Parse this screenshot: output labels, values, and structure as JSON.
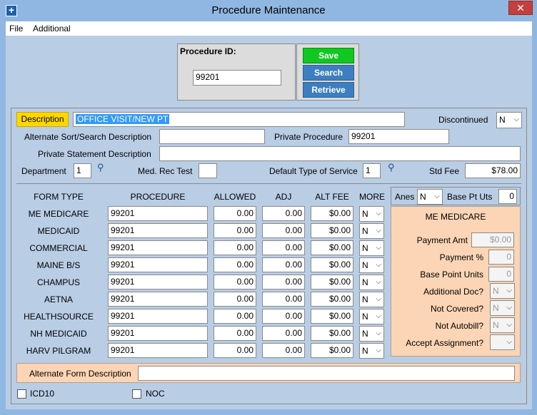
{
  "window": {
    "title": "Procedure Maintenance",
    "close_glyph": "✕",
    "app_icon": "+"
  },
  "menu": [
    {
      "label": "File"
    },
    {
      "label": "Additional"
    }
  ],
  "header": {
    "procedure_id_label": "Procedure ID:",
    "procedure_id_value": "99201",
    "save_label": "Save",
    "search_label": "Search",
    "retrieve_label": "Retrieve"
  },
  "details": {
    "description_label": "Description",
    "description_value": "OFFICE VISIT/NEW PT",
    "discontinued_label": "Discontinued",
    "discontinued_value": "N",
    "alt_sort_label": "Alternate Sort/Search Description",
    "alt_sort_value": "",
    "private_procedure_label": "Private Procedure",
    "private_procedure_value": "99201",
    "private_statement_label": "Private Statement Description",
    "private_statement_value": "",
    "department_label": "Department",
    "department_value": "1",
    "med_rec_test_label": "Med. Rec Test",
    "med_rec_test_value": "",
    "default_tos_label": "Default Type of Service",
    "default_tos_value": "1",
    "std_fee_label": "Std Fee",
    "std_fee_value": "$78.00"
  },
  "grid": {
    "headers": {
      "form_type": "FORM TYPE",
      "procedure": "PROCEDURE",
      "allowed": "ALLOWED",
      "adj": "ADJ",
      "alt_fee": "ALT FEE",
      "more": "MORE"
    },
    "rows": [
      {
        "form_type": "ME MEDICARE",
        "procedure": "99201",
        "allowed": "0.00",
        "adj": "0.00",
        "alt_fee": "$0.00",
        "more": "N"
      },
      {
        "form_type": "MEDICAID",
        "procedure": "99201",
        "allowed": "0.00",
        "adj": "0.00",
        "alt_fee": "$0.00",
        "more": "N"
      },
      {
        "form_type": "COMMERCIAL",
        "procedure": "99201",
        "allowed": "0.00",
        "adj": "0.00",
        "alt_fee": "$0.00",
        "more": "N"
      },
      {
        "form_type": "MAINE B/S",
        "procedure": "99201",
        "allowed": "0.00",
        "adj": "0.00",
        "alt_fee": "$0.00",
        "more": "N"
      },
      {
        "form_type": "CHAMPUS",
        "procedure": "99201",
        "allowed": "0.00",
        "adj": "0.00",
        "alt_fee": "$0.00",
        "more": "N"
      },
      {
        "form_type": "AETNA",
        "procedure": "99201",
        "allowed": "0.00",
        "adj": "0.00",
        "alt_fee": "$0.00",
        "more": "N"
      },
      {
        "form_type": "HEALTHSOURCE",
        "procedure": "99201",
        "allowed": "0.00",
        "adj": "0.00",
        "alt_fee": "$0.00",
        "more": "N"
      },
      {
        "form_type": "NH MEDICAID",
        "procedure": "99201",
        "allowed": "0.00",
        "adj": "0.00",
        "alt_fee": "$0.00",
        "more": "N"
      },
      {
        "form_type": "HARV PILGRAM",
        "procedure": "99201",
        "allowed": "0.00",
        "adj": "0.00",
        "alt_fee": "$0.00",
        "more": "N"
      }
    ]
  },
  "side": {
    "anes_label": "Anes",
    "anes_value": "N",
    "base_pt_uts_label": "Base Pt Uts",
    "base_pt_uts_value": "0",
    "section_title": "ME MEDICARE",
    "payment_amt_label": "Payment Amt",
    "payment_amt_value": "$0.00",
    "payment_pct_label": "Payment %",
    "payment_pct_value": "0",
    "base_point_units_label": "Base Point Units",
    "base_point_units_value": "0",
    "additional_doc_label": "Additional Doc?",
    "additional_doc_value": "N",
    "not_covered_label": "Not Covered?",
    "not_covered_value": "N",
    "not_autobill_label": "Not Autobill?",
    "not_autobill_value": "N",
    "accept_assignment_label": "Accept Assignment?",
    "accept_assignment_value": ""
  },
  "footer": {
    "alt_form_desc_label": "Alternate Form Description",
    "alt_form_desc_value": "",
    "icd10_label": "ICD10",
    "icd10_checked": false,
    "noc_label": "NOC",
    "noc_checked": false
  },
  "icons": {
    "lookup": "magnifier-icon",
    "dropdown": "chevron-down-icon"
  },
  "colors": {
    "title_bar": "#8fb7e2",
    "form_bg": "#b9cde5",
    "save_green": "#10c820",
    "button_blue": "#3d7ec0",
    "side_panel": "#fbd5b5",
    "description_label": "#ffd700",
    "selection": "#3399ff"
  }
}
